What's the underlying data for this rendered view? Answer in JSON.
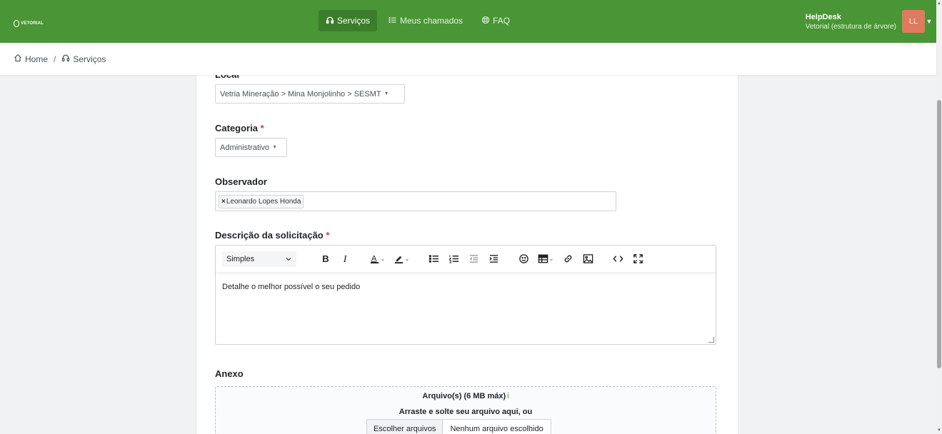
{
  "app": {
    "logo_text": "VETORIAL",
    "brand_color": "#4a9535",
    "accent_color": "#e07a5f"
  },
  "nav": {
    "items": [
      {
        "label": "Serviços",
        "icon": "headset-icon"
      },
      {
        "label": "Meus chamados",
        "icon": "list-icon"
      },
      {
        "label": "FAQ",
        "icon": "lifebuoy-icon"
      }
    ]
  },
  "user": {
    "name": "HelpDesk",
    "org": "Vetorial (estrutura de árvore)",
    "initials": "LL"
  },
  "breadcrumb": {
    "home": "Home",
    "separator": "/",
    "current": "Serviços"
  },
  "form": {
    "local": {
      "label": "Local",
      "value": "Vetria Mineração > Mina Monjolinho > SESMT"
    },
    "categoria": {
      "label": "Categoria",
      "required": "*",
      "value": "Administrativo"
    },
    "observador": {
      "label": "Observador",
      "tag_remove": "×",
      "tags": [
        "Leonardo Lopes Honda"
      ]
    },
    "descricao": {
      "label": "Descrição da solicitação",
      "required": "*",
      "format_value": "Simples",
      "placeholder": "Detalhe o melhor possível o seu pedido"
    },
    "anexo": {
      "label": "Anexo",
      "title": "Arquivo(s) (6 MB máx)",
      "info": "i",
      "drop_text": "Arraste e solte seu arquivo aqui, ou",
      "choose_button": "Escolher arquivos",
      "no_file": "Nenhum arquivo escolhido"
    }
  }
}
